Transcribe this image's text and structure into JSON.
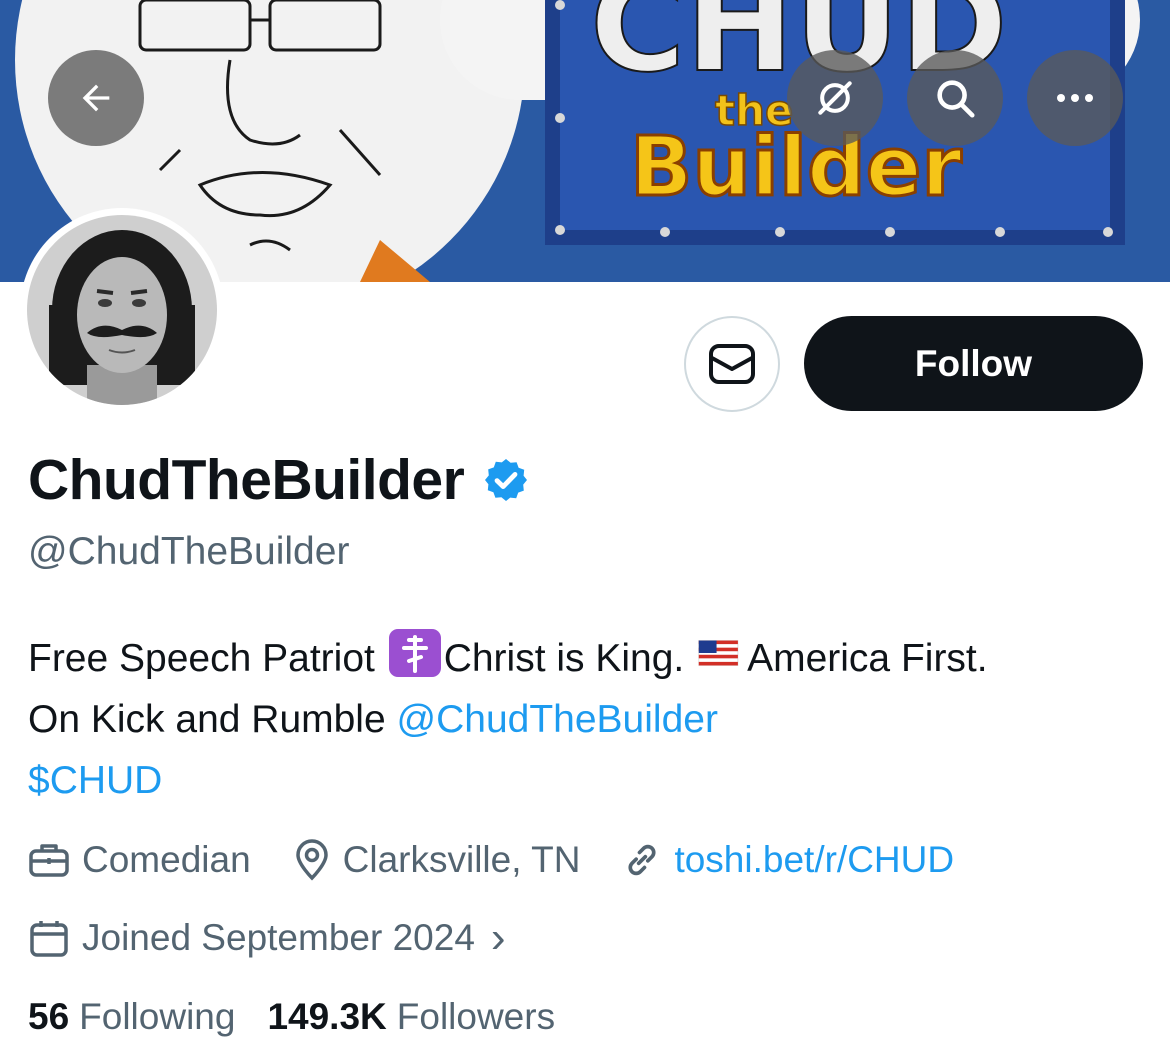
{
  "banner": {
    "art_text_top": "CHUD",
    "art_text_mid": "the",
    "art_text_bottom": "Builder"
  },
  "nav": {
    "back_icon": "arrow-left-icon",
    "grok_icon": "grok-icon",
    "search_icon": "search-icon",
    "more_icon": "more-horizontal-icon"
  },
  "actions": {
    "message_icon": "envelope-icon",
    "follow_label": "Follow"
  },
  "profile": {
    "display_name": "ChudTheBuilder",
    "verified": true,
    "handle": "@ChudTheBuilder"
  },
  "bio": {
    "line1_a": "Free Speech Patriot ",
    "line1_b": "Christ is King. ",
    "line1_c": "America First.",
    "line2_text": "On Kick and Rumble ",
    "line2_mention": "@ChudTheBuilder",
    "line3_cashtag": "$CHUD"
  },
  "meta": {
    "profession": "Comedian",
    "location": "Clarksville, TN",
    "website": "toshi.bet/r/CHUD",
    "joined": "Joined September 2024",
    "chevron": "›"
  },
  "counts": {
    "following_num": "56",
    "following_label": "Following",
    "followers_num": "149.3K",
    "followers_label": "Followers"
  },
  "colors": {
    "accent": "#1d9bf0",
    "text_primary": "#0f1419",
    "text_secondary": "#536471",
    "banner_blue": "#2a5aa3",
    "follow_bg": "#0f1419"
  }
}
